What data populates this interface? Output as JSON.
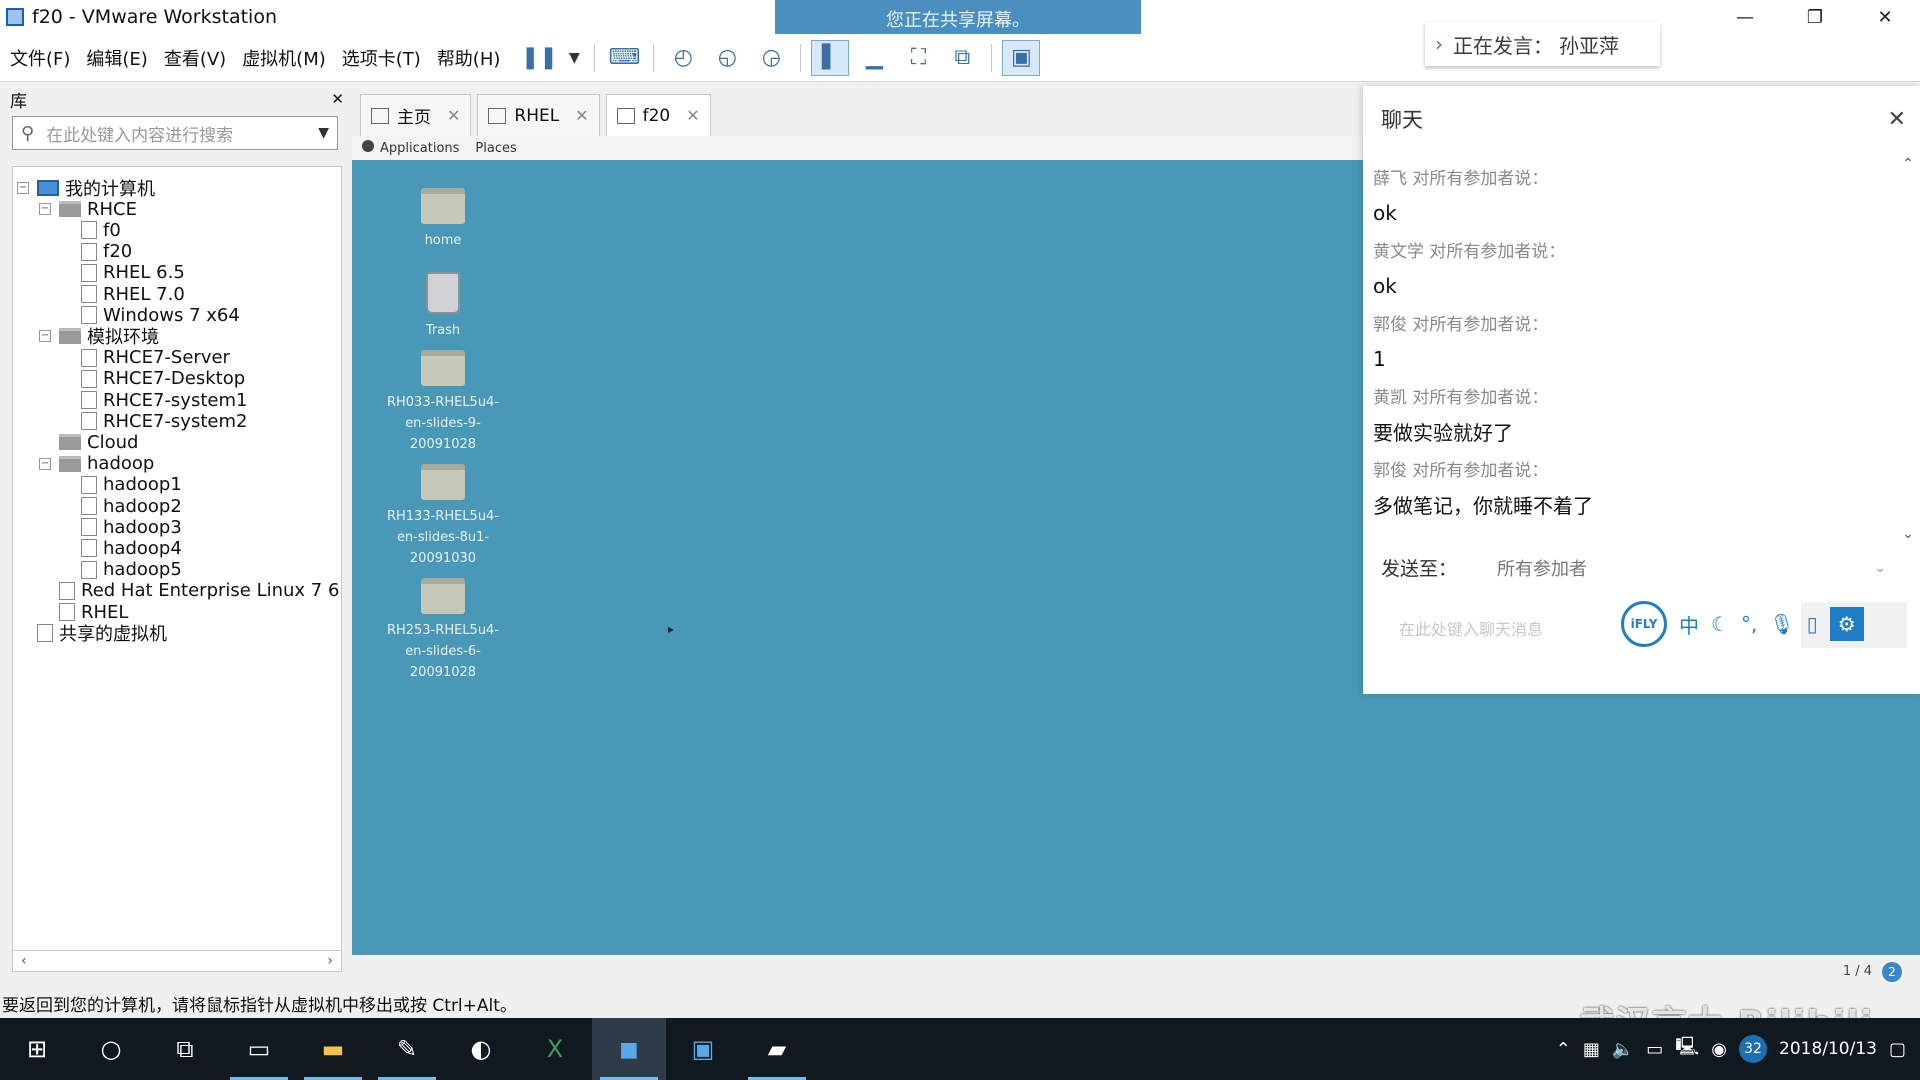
{
  "window": {
    "title": "f20 - VMware Workstation",
    "share_banner": "您正在共享屏幕。",
    "minimize": "—",
    "maximize": "❐",
    "close": "✕"
  },
  "menu": [
    "文件(F)",
    "编辑(E)",
    "查看(V)",
    "虚拟机(M)",
    "选项卡(T)",
    "帮助(H)"
  ],
  "speaker": {
    "label": "正在发言：",
    "name": "孙亚萍"
  },
  "library": {
    "title": "库",
    "close": "✕",
    "search_placeholder": "在此处键入内容进行搜索",
    "tree": [
      {
        "label": "我的计算机",
        "depth": 0,
        "type": "pc",
        "toggle": "⊟"
      },
      {
        "label": "RHCE",
        "depth": 1,
        "type": "folder",
        "toggle": "⊟"
      },
      {
        "label": "f0",
        "depth": 2,
        "type": "vm"
      },
      {
        "label": "f20",
        "depth": 2,
        "type": "vm-run"
      },
      {
        "label": "RHEL 6.5",
        "depth": 2,
        "type": "vm"
      },
      {
        "label": "RHEL 7.0",
        "depth": 2,
        "type": "vm"
      },
      {
        "label": "Windows 7 x64",
        "depth": 2,
        "type": "vm"
      },
      {
        "label": "模拟环境",
        "depth": 1,
        "type": "folder",
        "toggle": "⊟"
      },
      {
        "label": "RHCE7-Server",
        "depth": 2,
        "type": "vm"
      },
      {
        "label": "RHCE7-Desktop",
        "depth": 2,
        "type": "vm"
      },
      {
        "label": "RHCE7-system1",
        "depth": 2,
        "type": "vm"
      },
      {
        "label": "RHCE7-system2",
        "depth": 2,
        "type": "vm"
      },
      {
        "label": "Cloud",
        "depth": 1,
        "type": "folder"
      },
      {
        "label": "hadoop",
        "depth": 1,
        "type": "folder",
        "toggle": "⊟"
      },
      {
        "label": "hadoop1",
        "depth": 2,
        "type": "vm"
      },
      {
        "label": "hadoop2",
        "depth": 2,
        "type": "vm"
      },
      {
        "label": "hadoop3",
        "depth": 2,
        "type": "vm"
      },
      {
        "label": "hadoop4",
        "depth": 2,
        "type": "vm"
      },
      {
        "label": "hadoop5",
        "depth": 2,
        "type": "vm"
      },
      {
        "label": "Red Hat Enterprise Linux 7 6",
        "depth": 1,
        "type": "vm"
      },
      {
        "label": "RHEL",
        "depth": 1,
        "type": "vm"
      },
      {
        "label": "共享的虚拟机",
        "depth": 0,
        "type": "shared"
      }
    ]
  },
  "tabs": [
    {
      "label": "主页",
      "icon": "home-icon"
    },
    {
      "label": "RHEL",
      "icon": "vm-icon"
    },
    {
      "label": "f20",
      "icon": "vm-icon",
      "active": true
    }
  ],
  "gnome": {
    "applications": "Applications",
    "places": "Places"
  },
  "desktop_icons": [
    {
      "label": "home",
      "kind": "folder"
    },
    {
      "label": "Trash",
      "kind": "trash"
    },
    {
      "label": "RH033-RHEL5u4-en-slides-9-20091028",
      "lines": [
        "RH033-RHEL5u4-",
        "en-slides-9-",
        "20091028"
      ],
      "kind": "folder"
    },
    {
      "label": "RH133-RHEL5u4-en-slides-8u1-20091030",
      "lines": [
        "RH133-RHEL5u4-",
        "en-slides-8u1-",
        "20091030"
      ],
      "kind": "folder"
    },
    {
      "label": "RH253-RHEL5u4-en-slides-6-20091028",
      "lines": [
        "RH253-RHEL5u4-",
        "en-slides-6-",
        "20091028"
      ],
      "kind": "folder"
    }
  ],
  "vm_status": {
    "page": "1 / 4",
    "badge": "2"
  },
  "chat": {
    "title": "聊天",
    "messages": [
      {
        "sender": "薛飞 对所有参加者说：",
        "text": "ok"
      },
      {
        "sender": "黄文学 对所有参加者说：",
        "text": "ok"
      },
      {
        "sender": "郭俊 对所有参加者说：",
        "text": "1"
      },
      {
        "sender": "黄凯 对所有参加者说：",
        "text": "要做实验就好了"
      },
      {
        "sender": "郭俊 对所有参加者说：",
        "text": "多做笔记，你就睡不着了"
      }
    ],
    "send_to_label": "发送至：",
    "send_to_value": "所有参加者",
    "input_placeholder": "在此处键入聊天消息",
    "ime": {
      "logo": "iFLY",
      "lang": "中"
    }
  },
  "statusbar": {
    "text": "要返回到您的计算机，请将鼠标指针从虚拟机中移出或按 Ctrl+Alt。"
  },
  "watermark": "武汉言大 Bilibili",
  "taskbar": {
    "clock_badge": "32",
    "date": "2018/10/13"
  }
}
